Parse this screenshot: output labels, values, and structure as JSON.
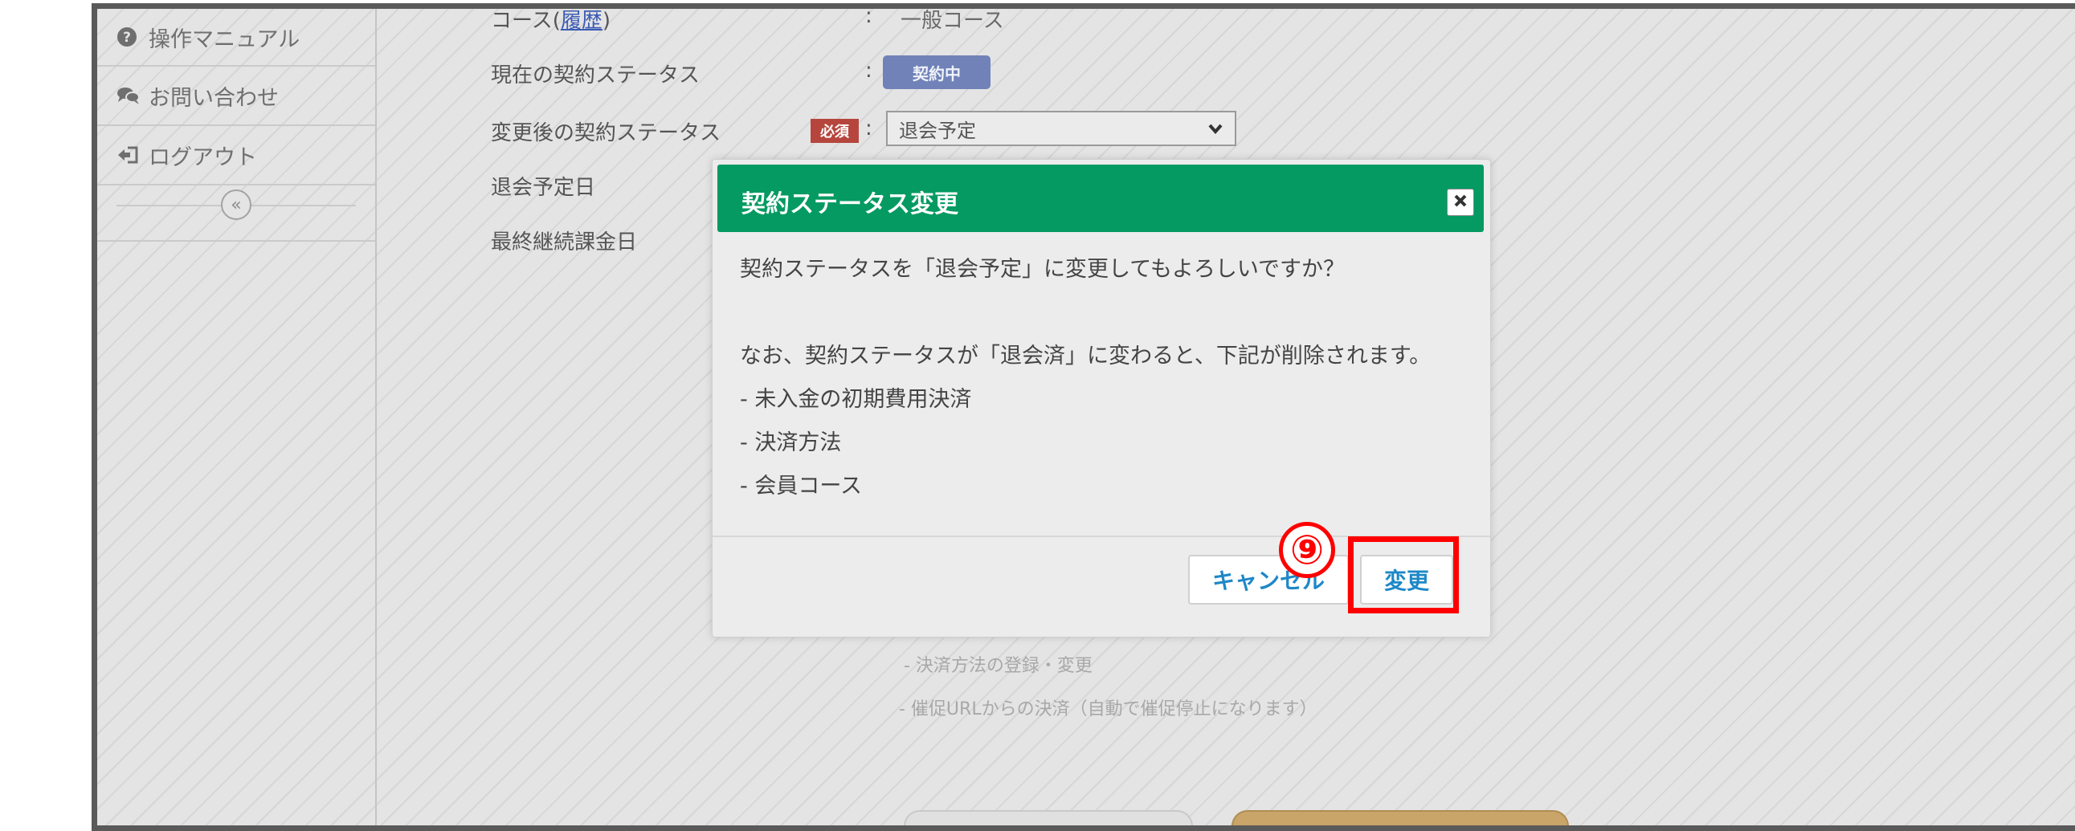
{
  "sidebar": {
    "items": [
      {
        "label": "操作マニュアル",
        "icon": "question-circle-icon"
      },
      {
        "label": "お問い合わせ",
        "icon": "chat-icon"
      },
      {
        "label": "ログアウト",
        "icon": "logout-icon"
      }
    ],
    "collapse_symbol": "«"
  },
  "form": {
    "course_label": "コース(",
    "course_link": "履歴",
    "course_label_end": ")",
    "course_value": "一般コース",
    "current_status_label": "現在の契約ステータス",
    "current_status_value": "契約中",
    "new_status_label": "変更後の契約ステータス",
    "required_badge": "必須",
    "new_status_value": "退会予定",
    "planned_leave_label": "退会予定日",
    "last_billing_label": "最終継続課金日",
    "colon": ":"
  },
  "background_notes": {
    "line1": "- 決済方法の登録・変更",
    "line2": "- 催促URLからの決済（自動で催促停止になります）"
  },
  "modal": {
    "title": "契約ステータス変更",
    "message": "契約ステータスを「退会予定」に変更してもよろしいですか？",
    "notice": "なお、契約ステータスが「退会済」に変わると、下記が削除されます。",
    "items": [
      "- 未入金の初期費用決済",
      "- 決済方法",
      "- 会員コース"
    ],
    "cancel_label": "キャンセル",
    "confirm_label": "変更"
  },
  "annotation": {
    "step": "⑨",
    "color": "#ff0000"
  },
  "colors": {
    "modal_header": "#049a62",
    "button_text": "#1e88c7",
    "status_badge": "#7082b8",
    "required_badge": "#b6463d"
  }
}
